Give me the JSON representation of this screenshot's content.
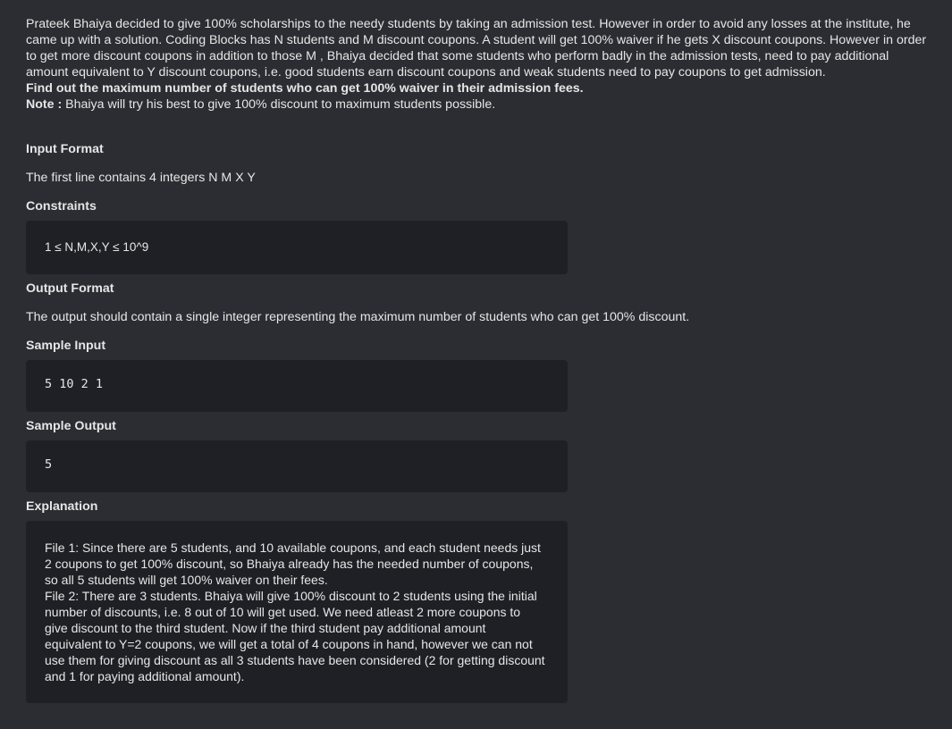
{
  "intro": {
    "paragraph": "Prateek Bhaiya decided to give 100% scholarships to the needy students by taking an admission test. However in order to avoid any losses at the institute, he came up with a solution. Coding Blocks has N students and M discount coupons. A student will get 100% waiver if he gets X discount coupons. However in order to get more discount coupons in addition to those M , Bhaiya decided that some students who perform badly in the admission tests, need to pay additional amount equivalent to Y discount coupons, i.e. good students earn discount coupons and weak students need to pay coupons to get admission.",
    "question": "Find out the maximum number of students who can get 100% waiver in their admission fees.",
    "note_label": "Note :",
    "note_text": " Bhaiya will try his best to give 100% discount to maximum students possible."
  },
  "sections": {
    "input_format": {
      "heading": "Input Format",
      "text": "The first line contains 4 integers N M X Y"
    },
    "constraints": {
      "heading": "Constraints",
      "code": "1 ≤ N,M,X,Y ≤ 10^9"
    },
    "output_format": {
      "heading": "Output Format",
      "text": "The output should contain a single integer representing the maximum number of students who can get 100% discount."
    },
    "sample_input": {
      "heading": "Sample Input",
      "code": "5 10 2 1"
    },
    "sample_output": {
      "heading": "Sample Output",
      "code": "5"
    },
    "explanation": {
      "heading": "Explanation",
      "file1": "File 1: Since there are 5 students, and 10 available coupons, and each student needs just 2 coupons to get 100% discount, so Bhaiya already has the needed number of coupons, so all 5 students will get 100% waiver on their fees.",
      "file2": "File 2: There are 3 students. Bhaiya will give 100% discount to 2 students using the initial number of discounts, i.e. 8 out of 10 will get used. We need atleast 2 more coupons to give discount to the third student. Now if the third student pay additional amount equivalent to Y=2 coupons, we will get a total of 4 coupons in hand, however we can not use them for giving discount as all 3 students have been considered (2 for getting discount and 1 for paying additional amount)."
    }
  }
}
